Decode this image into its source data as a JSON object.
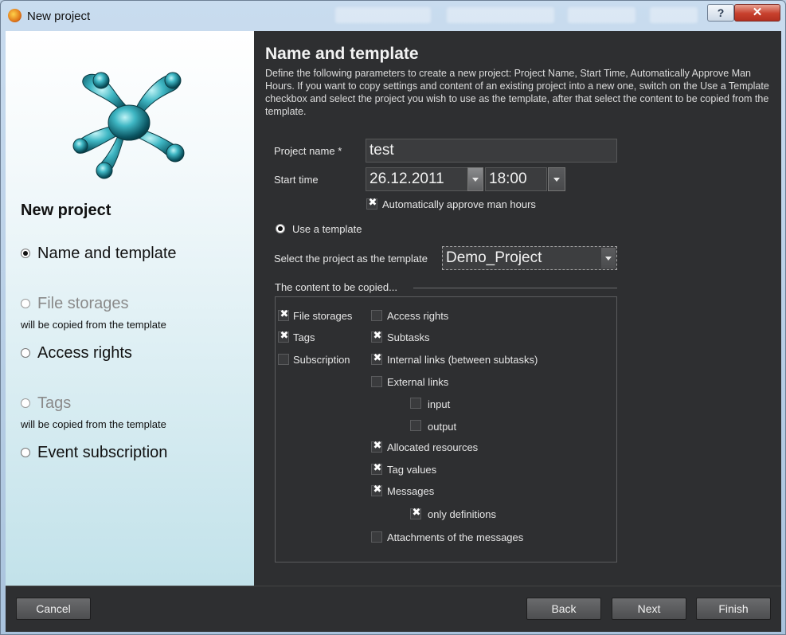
{
  "window": {
    "title": "New project",
    "help_glyph": "?",
    "close_glyph": "✕"
  },
  "sidebar": {
    "heading": "New project",
    "steps": [
      {
        "label": "Name and template",
        "active": true,
        "note": ""
      },
      {
        "label": "File storages",
        "active": false,
        "note": "will be copied from the template"
      },
      {
        "label": "Access rights",
        "active": false,
        "note": ""
      },
      {
        "label": "Tags",
        "active": false,
        "note": "will be copied from the template"
      },
      {
        "label": "Event subscription",
        "active": false,
        "note": ""
      }
    ]
  },
  "main": {
    "title": "Name and template",
    "description": "Define the following parameters to create a new project: Project Name, Start Time, Automatically Approve Man Hours. If you want to copy settings and content of an existing project into a new one, switch on the Use a Template checkbox and select the project you wish to use as the template, after that select the content to be copied from the template.",
    "project_name_label": "Project name *",
    "project_name_value": "test",
    "start_time_label": "Start time",
    "start_date": "26.12.2011",
    "start_clock": "18:00",
    "auto_approve_label": "Automatically approve man hours",
    "auto_approve_checked": true,
    "use_template_label": "Use a template",
    "use_template_selected": true,
    "select_template_label": "Select the project as the template",
    "template_value": "Demo_Project",
    "content_heading": "The content to be copied...",
    "content_left": [
      {
        "label": "File storages",
        "checked": true
      },
      {
        "label": "Tags",
        "checked": true
      },
      {
        "label": "Subscription",
        "checked": false
      }
    ],
    "content_right": [
      {
        "label": "Access rights",
        "checked": false
      },
      {
        "label": "Subtasks",
        "checked": true
      },
      {
        "label": "Internal links (between subtasks)",
        "checked": true
      },
      {
        "label": "External links",
        "checked": false
      },
      {
        "label": "input",
        "checked": false
      },
      {
        "label": "output",
        "checked": false
      },
      {
        "label": "Allocated resources",
        "checked": true
      },
      {
        "label": "Tag values",
        "checked": true
      },
      {
        "label": "Messages",
        "checked": true
      },
      {
        "label": "only definitions",
        "checked": true
      },
      {
        "label": "Attachments of the messages",
        "checked": false
      }
    ]
  },
  "footer": {
    "cancel": "Cancel",
    "back": "Back",
    "next": "Next",
    "finish": "Finish"
  }
}
